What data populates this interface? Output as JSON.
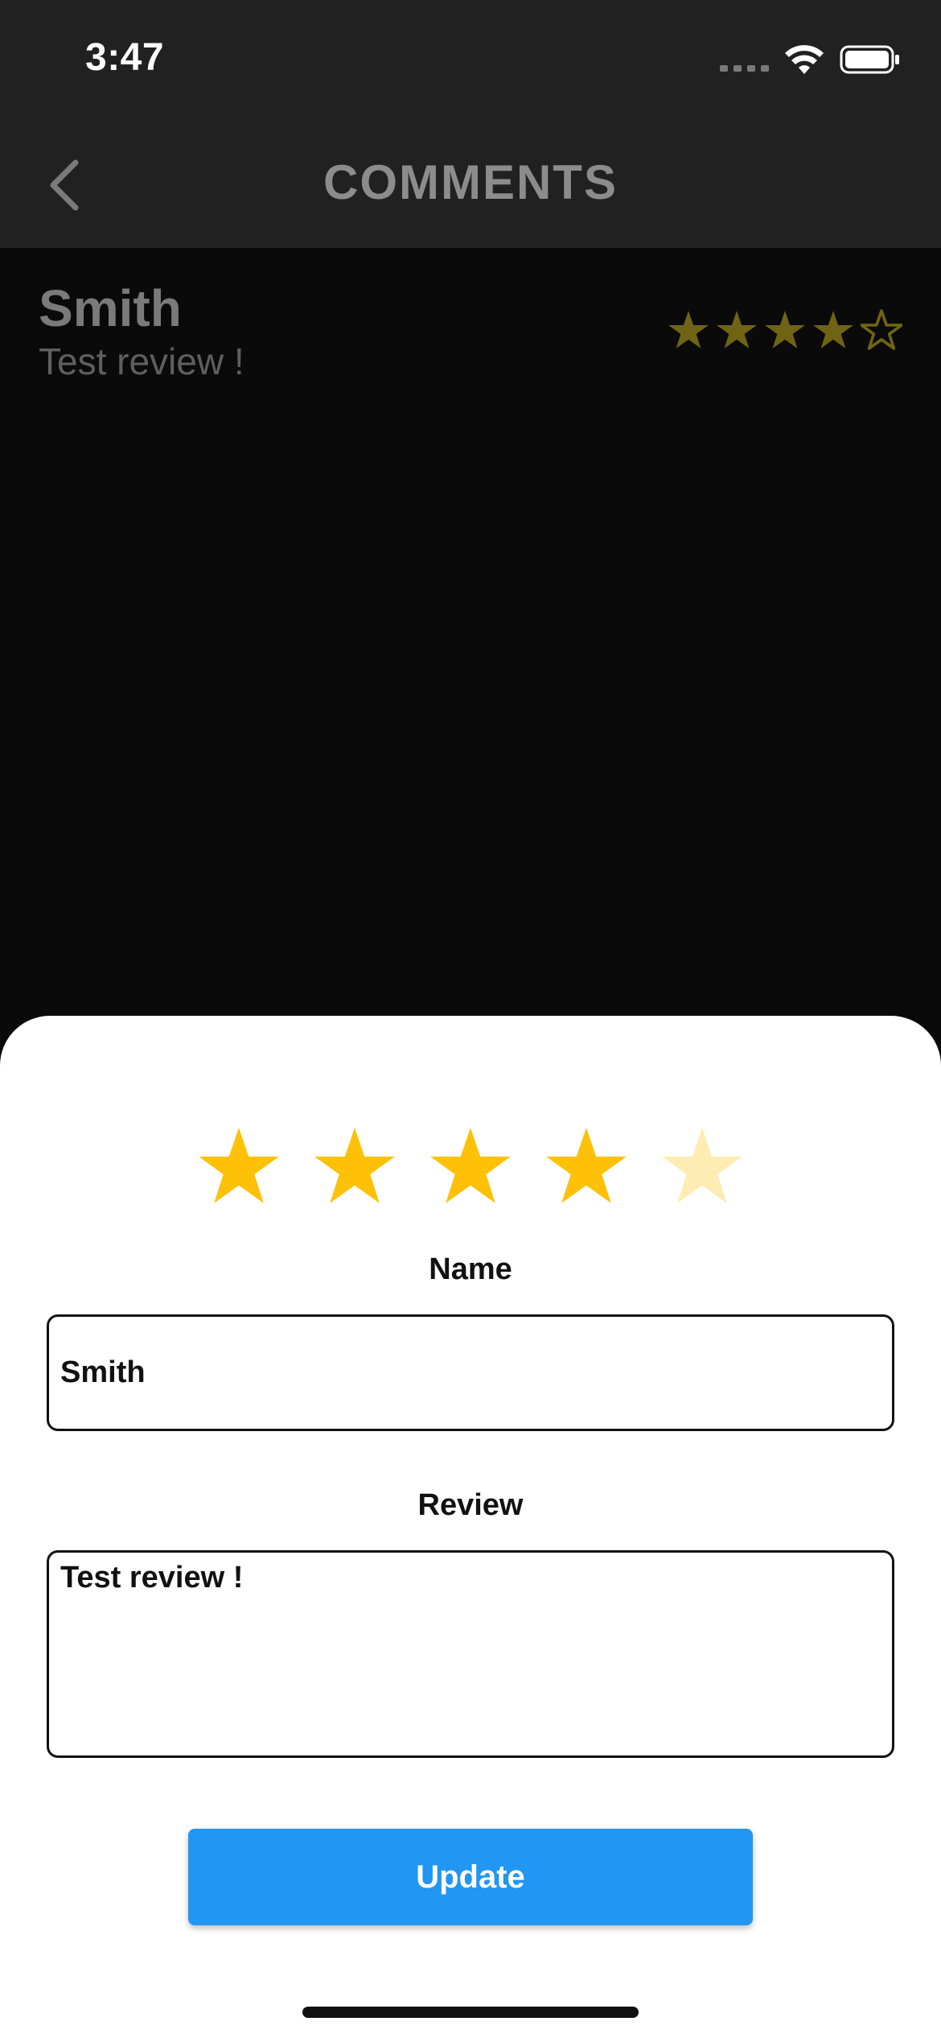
{
  "status_bar": {
    "time": "3:47"
  },
  "app_bar": {
    "title": "COMMENTS"
  },
  "comments": [
    {
      "name": "Smith",
      "review": "Test review !",
      "rating": 4,
      "max_rating": 5
    }
  ],
  "sheet": {
    "rating": 4,
    "max_rating": 5,
    "name_label": "Name",
    "name_value": "Smith",
    "review_label": "Review",
    "review_value": "Test review !",
    "update_label": "Update"
  },
  "colors": {
    "star_active": "#FFC107",
    "star_inactive": "#FFECB3",
    "comment_star_dim": "#6e6414",
    "button": "#2196F3",
    "app_bar": "#212121"
  },
  "icons": {
    "back": "chevron-left-icon",
    "wifi": "wifi-icon",
    "battery": "battery-icon",
    "signal": "signal-icon",
    "star": "star-icon"
  }
}
